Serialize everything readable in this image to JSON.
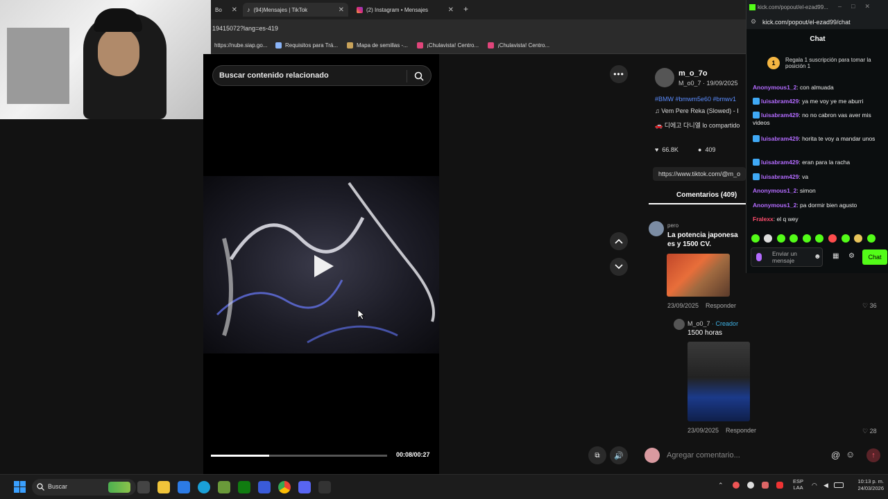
{
  "browser": {
    "tabs": [
      {
        "label": "Bo"
      },
      {
        "label": "(94)Mensajes | TikTok"
      },
      {
        "label": "(2) Instagram • Mensajes"
      }
    ],
    "url": "19415072?lang=es-419",
    "bookmarks": [
      "https://nube.siap.go...",
      "Requisitos para Trá...",
      "Mapa de semillas -...",
      "¡Chulavista! Centro...",
      "¡Chulavista! Centro..."
    ]
  },
  "tiktok": {
    "search_placeholder": "Buscar contenido relacionado",
    "time": "00:08/00:27",
    "progress": 0.33,
    "author": {
      "username": "m_o_7o",
      "subline": "M_o0_7 · 19/09/2025"
    },
    "hashtags": "#BMW #bmwm5e60 #bmwv1",
    "music": "Vem Pere Reka (Slowed) - I",
    "shared": "🚗 디에고 다니엘 lo compartido",
    "likes": "66.8K",
    "comments_count": "409",
    "link": "https://www.tiktok.com/@m_o",
    "comments_tab": "Comentarios (409)",
    "comment1": {
      "user": "pero",
      "text": "La potencia japonesa es y 1500 CV.",
      "date": "23/09/2025",
      "reply": "Responder",
      "likes": "36"
    },
    "comment2": {
      "user": "M_o0_7",
      "creator": "· Creador",
      "text": "1500 horas",
      "date": "23/09/2025",
      "reply": "Responder",
      "likes": "28"
    },
    "comment_placeholder": "Agregar comentario..."
  },
  "chat": {
    "window_url_short": "kick.com/popout/el-ezad99...",
    "url": "kick.com/popout/el-ezad99/chat",
    "title": "Chat",
    "pinned": "Regala 1 suscripción para tomar la posición 1",
    "pinned_rank": "1",
    "messages": [
      {
        "user": "Anonymous1_2",
        "color": "#b36bff",
        "text": ": con almuada",
        "badge": false
      },
      {
        "user": "luisabram429",
        "color": "#b36bff",
        "text": ": ya me voy ye me aburri",
        "badge": true
      },
      {
        "user": "luisabram429",
        "color": "#b36bff",
        "text": ": no no cabron vas aver mis videos",
        "badge": true
      },
      {
        "user": "luisabram429",
        "color": "#b36bff",
        "text": ": horita te voy a mandar unos",
        "badge": true
      },
      {
        "user": "luisabram429",
        "color": "#b36bff",
        "text": ": eran para la racha",
        "badge": true
      },
      {
        "user": "luisabram429",
        "color": "#b36bff",
        "text": ": va",
        "badge": true
      },
      {
        "user": "Anonymous1_2",
        "color": "#b36bff",
        "text": ": simon",
        "badge": false
      },
      {
        "user": "Anonymous1_2",
        "color": "#b36bff",
        "text": ": pa dormir bien agusto",
        "badge": false
      },
      {
        "user": "Fralexx",
        "color": "#ff4d6d",
        "text": ": el q wey",
        "badge": false
      }
    ],
    "input_placeholder": "Enviar un mensaje",
    "send_label": "Chat",
    "accent": "#53fc18"
  },
  "taskbar": {
    "search_label": "Buscar",
    "lang": "ESP",
    "lang2": "LAA",
    "time": "10:13 p. m.",
    "date": "24/03/2026"
  }
}
